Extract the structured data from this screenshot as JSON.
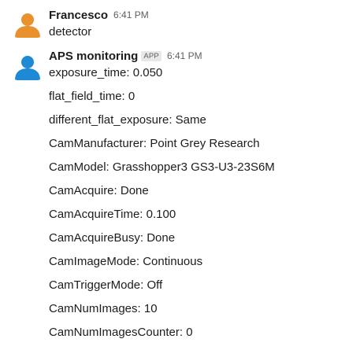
{
  "messages": [
    {
      "sender": "Francesco",
      "time": "6:41 PM",
      "avatar_color": "#e8912d",
      "avatar_icon": "person-icon",
      "text": "detector"
    },
    {
      "sender": "APS monitoring",
      "badge": "APP",
      "time": "6:41 PM",
      "avatar_color": "#1e8ad6",
      "avatar_icon": "person-icon",
      "lines": [
        "exposure_time: 0.050",
        "flat_field_time: 0",
        "different_flat_exposure: Same",
        "CamManufacturer: Point Grey Research",
        "CamModel: Grasshopper3 GS3-U3-23S6M",
        "CamAcquire: Done",
        "CamAcquireTime: 0.100",
        "CamAcquireBusy: Done",
        "CamImageMode: Continuous",
        "CamTriggerMode: Off",
        "CamNumImages: 10",
        "CamNumImagesCounter: 0"
      ]
    }
  ]
}
